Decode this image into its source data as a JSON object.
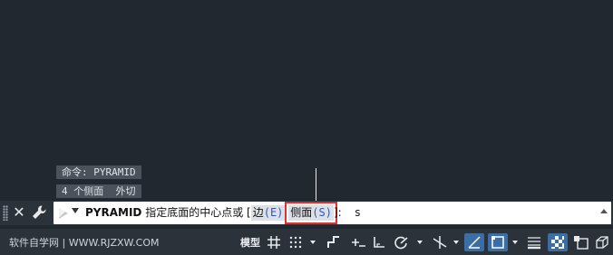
{
  "history": {
    "line1": "命令: PYRAMID",
    "line2": "4 个侧面  外切"
  },
  "command": {
    "name": "PYRAMID",
    "prompt": "指定底面的中心点或 [",
    "options": [
      {
        "label": "边",
        "key": "(E)"
      },
      {
        "label": "侧面",
        "key": "(S)"
      }
    ],
    "closing": "]:",
    "input": "s"
  },
  "status": {
    "watermark": "软件自学网 | WWW.RJZXW.COM",
    "model_label": "模型"
  },
  "icons": [
    "close-icon",
    "wrench-icon",
    "command-prompt-icon",
    "grid-icon",
    "snap-icon",
    "infer-constraints-icon",
    "dynamic-input-icon",
    "ortho-icon",
    "polar-tracking-icon",
    "isodraft-icon",
    "object-snap-tracking-icon",
    "object-snap-icon",
    "lineweight-icon",
    "transparency-icon",
    "selection-cycling-icon",
    "3d-osnap-icon"
  ],
  "colors": {
    "background": "#212830",
    "active_option_outline": "#e0312f",
    "option_key": "#2f59b5",
    "toggle_active": "#3a6ea5"
  }
}
